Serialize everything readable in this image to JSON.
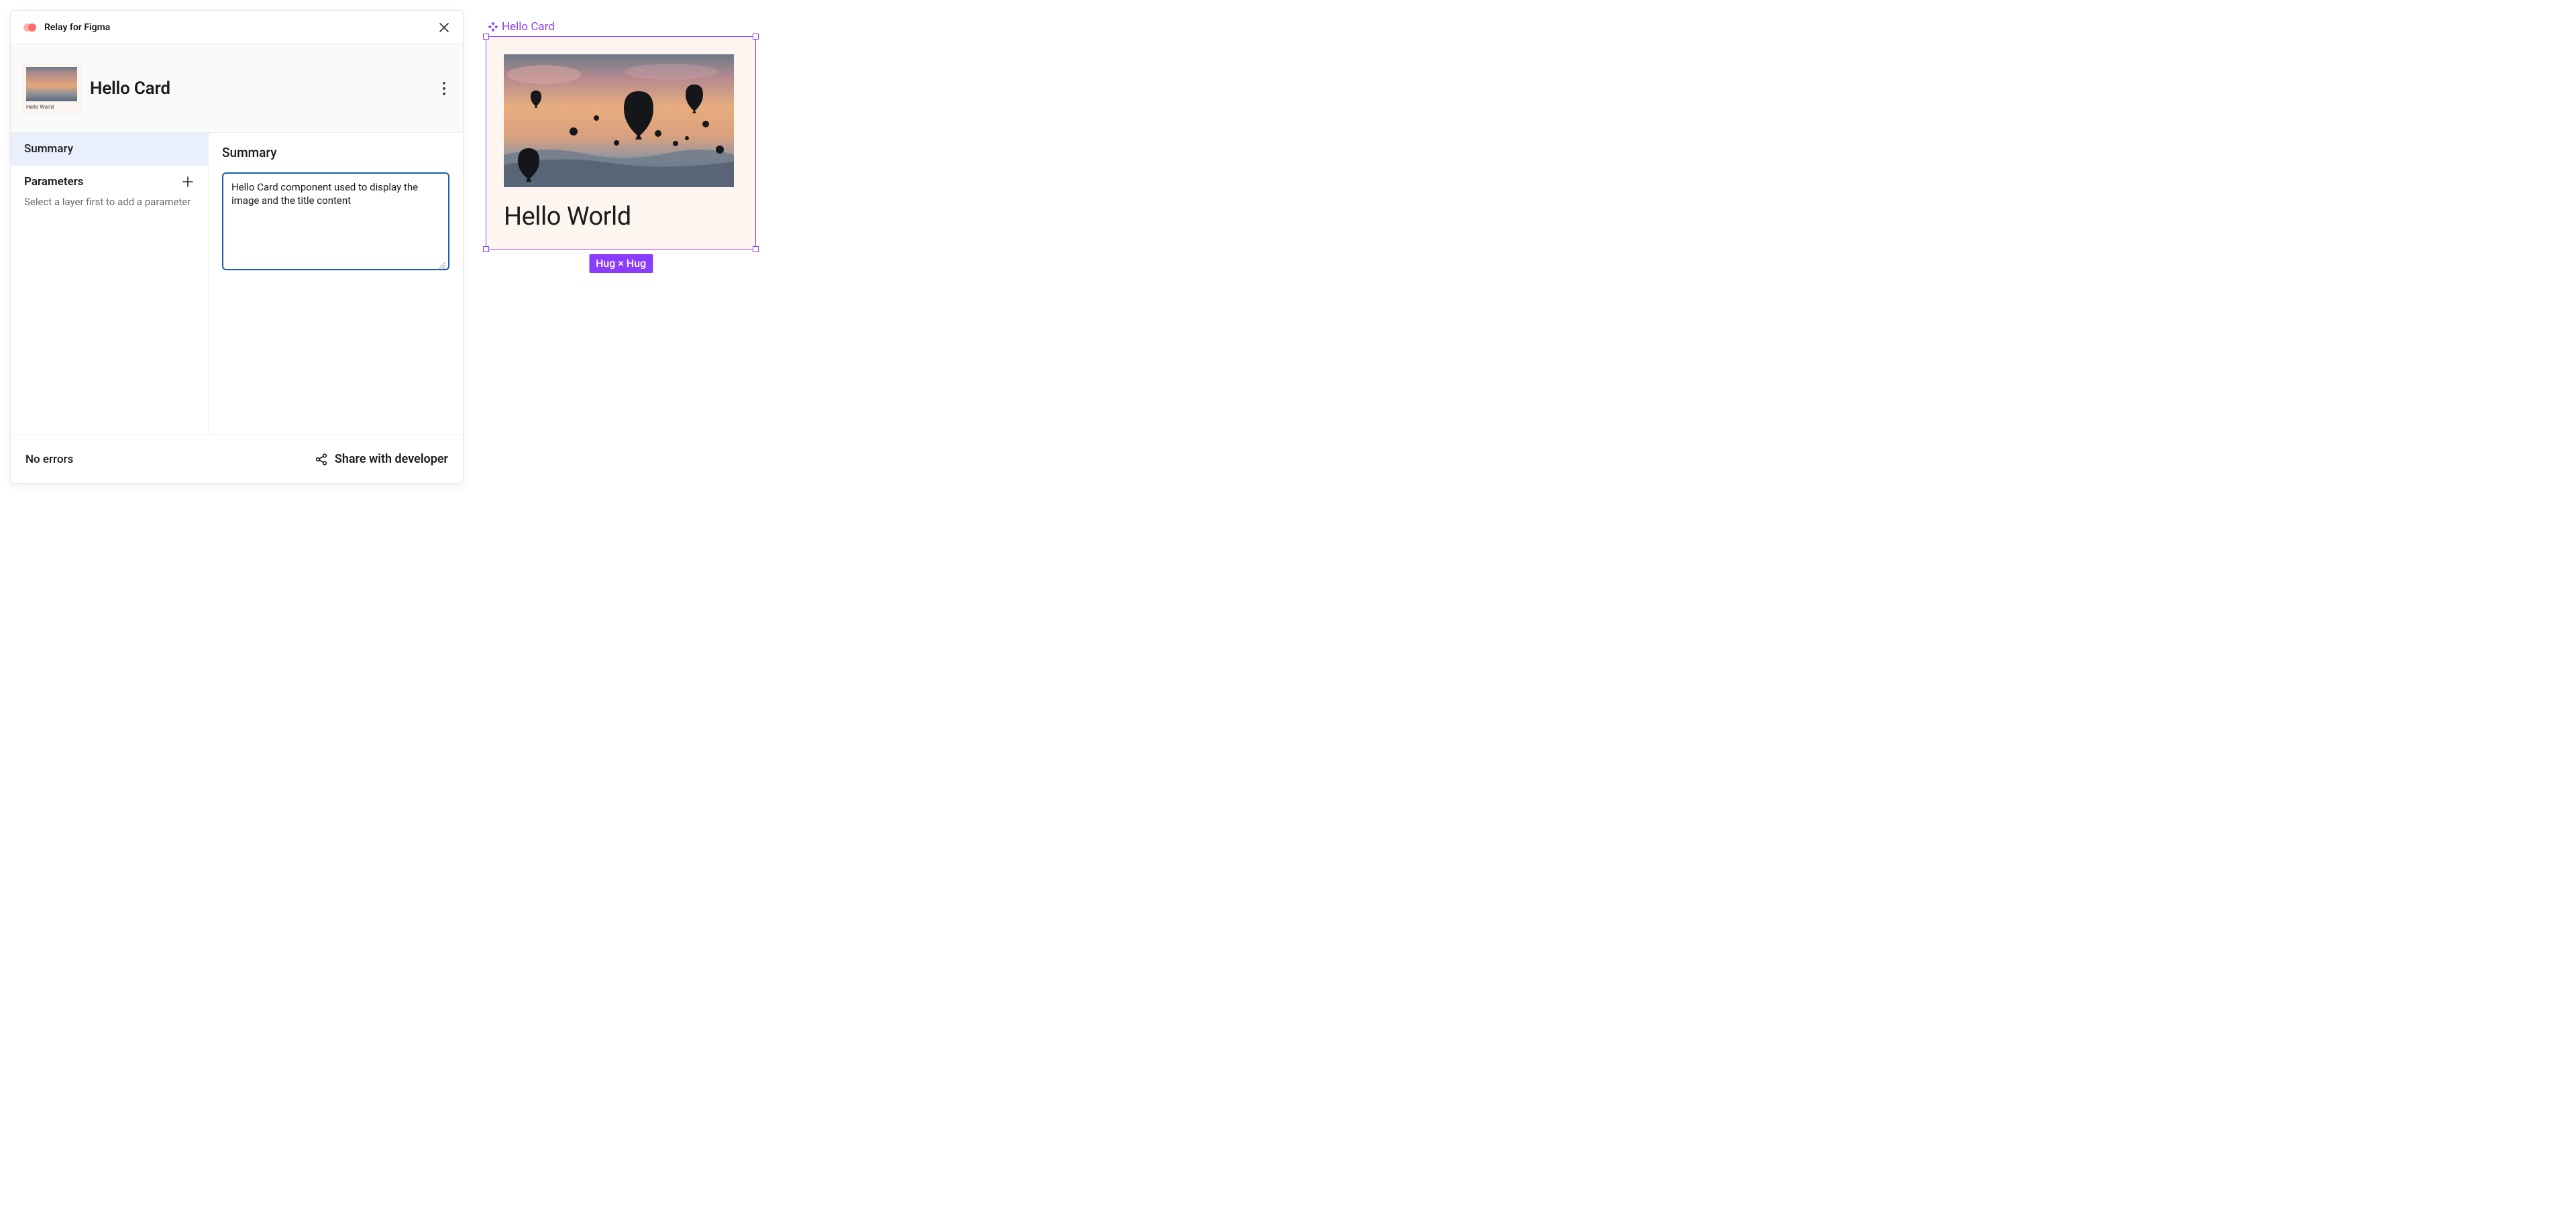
{
  "plugin": {
    "title": "Relay for Figma",
    "close_icon": "close-icon"
  },
  "component": {
    "name": "Hello Card",
    "thumb_caption": "Hello World"
  },
  "sidebar": {
    "tab_summary": "Summary",
    "parameters_label": "Parameters",
    "parameters_hint": "Select a layer first to add a parameter"
  },
  "main": {
    "heading": "Summary",
    "summary_value": "Hello Card component used to display the image and the title content"
  },
  "footer": {
    "errors": "No errors",
    "share_label": "Share with developer"
  },
  "canvas": {
    "frame_label": "Hello Card",
    "card_title": "Hello World",
    "size_pill": "Hug × Hug"
  },
  "colors": {
    "accent_purple": "#8b3dff",
    "summary_border": "#1e5ea7",
    "logo_coral": "#ff6b6b",
    "card_bg": "#fdf6f0"
  }
}
